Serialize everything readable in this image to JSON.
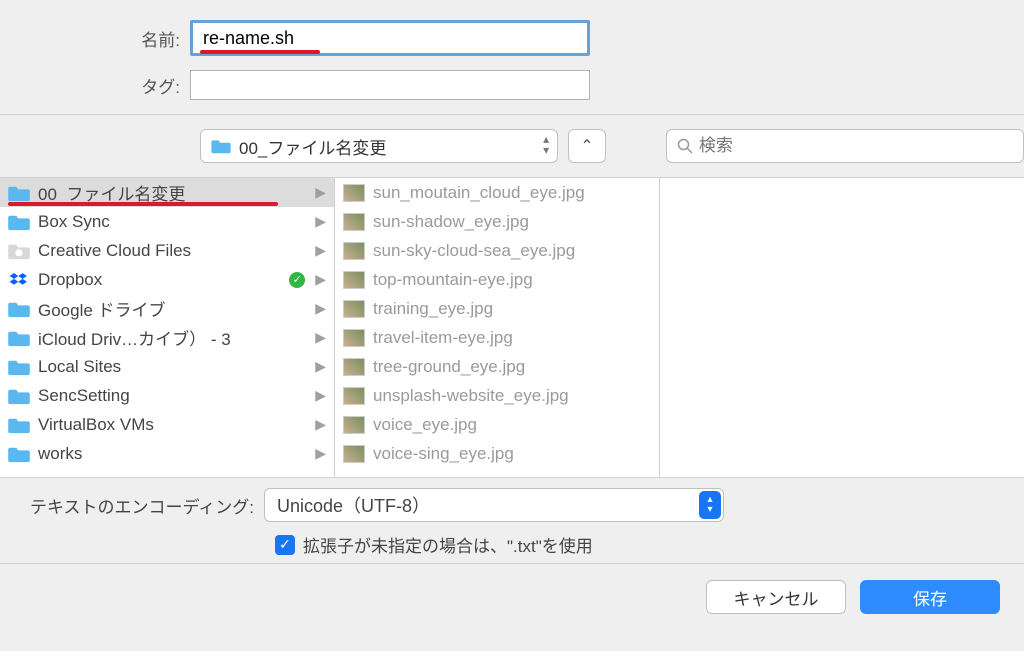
{
  "labels": {
    "name": "名前:",
    "tag": "タグ:"
  },
  "name_value": "re-name.sh",
  "tag_value": "",
  "location": {
    "current": "00_ファイル名変更"
  },
  "search": {
    "placeholder": "検索"
  },
  "column1": [
    {
      "label": "00_ファイル名変更",
      "icon": "folder",
      "has_children": true,
      "selected": true,
      "underline": true
    },
    {
      "label": "Box Sync",
      "icon": "folder",
      "has_children": true
    },
    {
      "label": "Creative Cloud Files",
      "icon": "cc-folder",
      "has_children": true
    },
    {
      "label": "Dropbox",
      "icon": "dropbox",
      "has_children": true,
      "checked": true
    },
    {
      "label": "Google ドライブ",
      "icon": "folder",
      "has_children": true
    },
    {
      "label": "iCloud Driv…カイブ） - 3",
      "icon": "folder",
      "has_children": true
    },
    {
      "label": "Local Sites",
      "icon": "folder",
      "has_children": true
    },
    {
      "label": "SencSetting",
      "icon": "folder",
      "has_children": true
    },
    {
      "label": "VirtualBox VMs",
      "icon": "folder",
      "has_children": true
    },
    {
      "label": "works",
      "icon": "folder",
      "has_children": true
    }
  ],
  "column2": [
    {
      "label": "sun_moutain_cloud_eye.jpg"
    },
    {
      "label": "sun-shadow_eye.jpg"
    },
    {
      "label": "sun-sky-cloud-sea_eye.jpg"
    },
    {
      "label": "top-mountain-eye.jpg"
    },
    {
      "label": "training_eye.jpg"
    },
    {
      "label": "travel-item-eye.jpg"
    },
    {
      "label": "tree-ground_eye.jpg"
    },
    {
      "label": "unsplash-website_eye.jpg"
    },
    {
      "label": "voice_eye.jpg"
    },
    {
      "label": "voice-sing_eye.jpg"
    }
  ],
  "encoding": {
    "label": "テキストのエンコーディング:",
    "value": "Unicode（UTF-8）"
  },
  "use_txt_checkbox": {
    "checked": true,
    "label": "拡張子が未指定の場合は、\".txt\"を使用"
  },
  "buttons": {
    "cancel": "キャンセル",
    "save": "保存"
  }
}
